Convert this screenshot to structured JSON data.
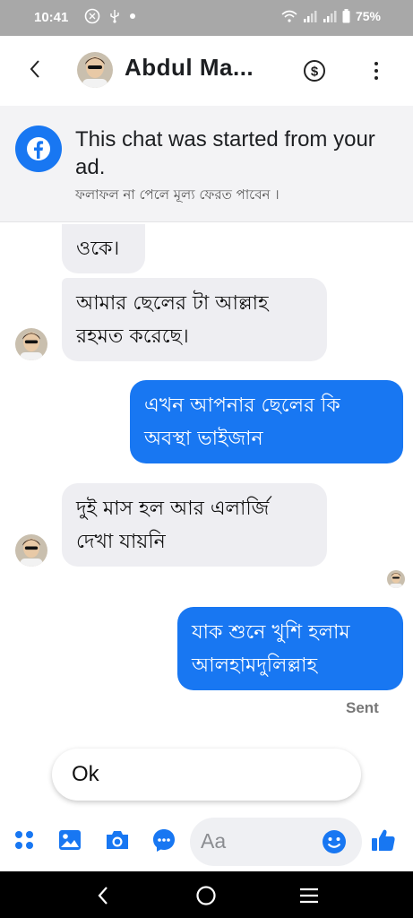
{
  "status_bar": {
    "time": "10:41",
    "battery": "75%"
  },
  "header": {
    "contact_name": "Abdul Ma..."
  },
  "ad_banner": {
    "title": "This chat was started from your ad.",
    "subtitle": "ফলাফল না পেলে মূল্য ফেরত পাবেন ।"
  },
  "messages": [
    {
      "direction": "in",
      "lines": [
        "ওকে।"
      ]
    },
    {
      "direction": "in",
      "lines": [
        "আমার ছেলের টা আল্লাহ",
        "রহমত করেছে।"
      ]
    },
    {
      "direction": "out",
      "lines": [
        "এখন আপনার ছেলের কি",
        "অবস্থা ভাইজান"
      ]
    },
    {
      "direction": "in",
      "lines": [
        "দুই মাস হল আর এলার্জি",
        "দেখা যায়নি"
      ]
    },
    {
      "direction": "out",
      "lines": [
        "যাক শুনে খুশি হলাম",
        "আলহামদুলিল্লাহ"
      ]
    }
  ],
  "sent_status": "Sent",
  "quick_reply": "Ok",
  "composer": {
    "placeholder": "Aa"
  },
  "colors": {
    "accent": "#1877f2",
    "incoming_bubble": "#eeeef2",
    "status_bar": "#a8a8a8"
  }
}
